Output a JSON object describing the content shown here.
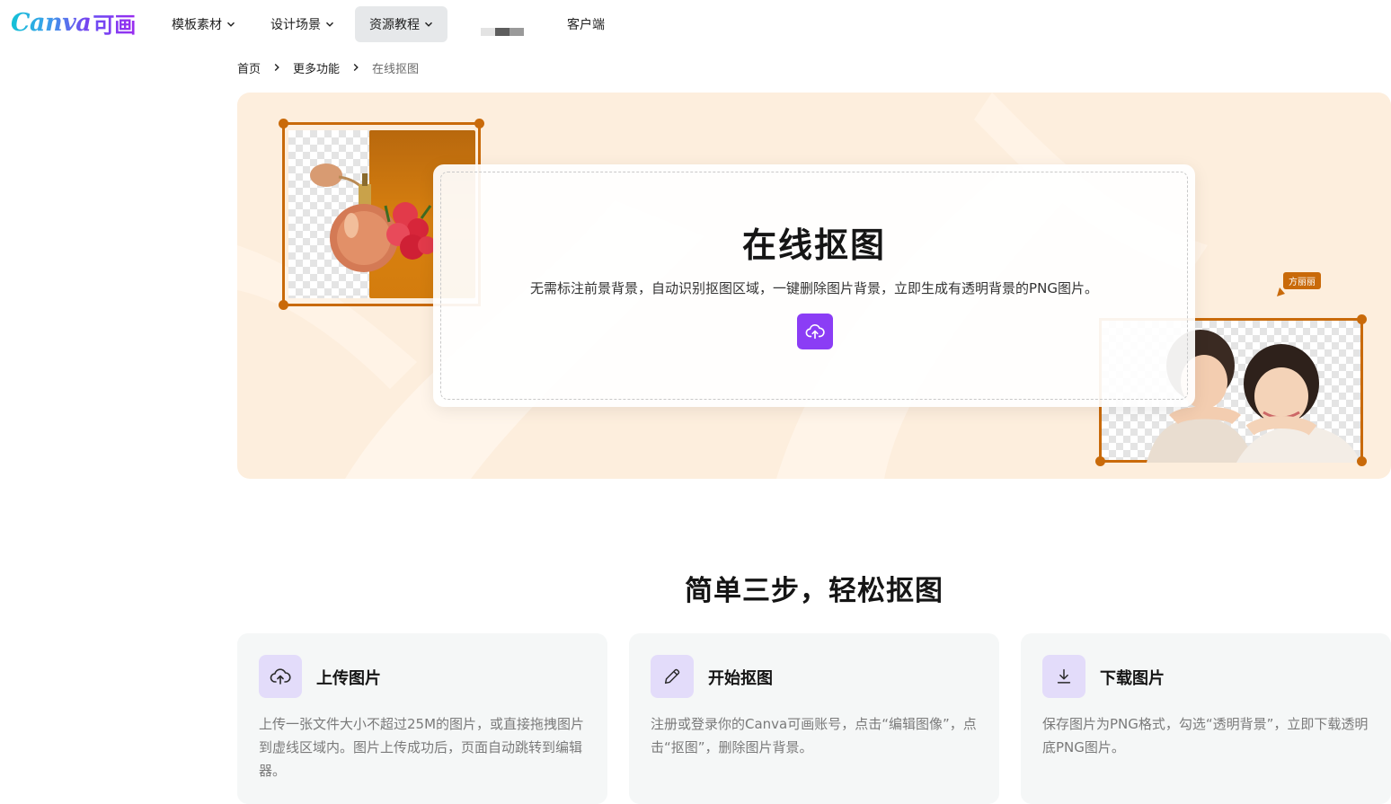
{
  "nav": {
    "logo_text": "Canva",
    "logo_cn": "可画",
    "items": [
      {
        "label": "模板素材"
      },
      {
        "label": "设计场景"
      },
      {
        "label": "资源教程"
      }
    ],
    "client_label": "客户端"
  },
  "breadcrumb": {
    "items": [
      "首页",
      "更多功能"
    ],
    "current": "在线抠图"
  },
  "hero": {
    "title": "在线抠图",
    "description": "无需标注前景背景，自动识别抠图区域，一键删除图片背景，立即生成有透明背景的PNG图片。",
    "upload_icon": "cloud-upload-icon",
    "tag": "方丽丽",
    "accent_color": "#c96a0a",
    "button_color": "#8b3df5"
  },
  "steps": {
    "title": "简单三步，轻松抠图",
    "items": [
      {
        "icon": "cloud-upload-icon",
        "name": "上传图片",
        "desc": "上传一张文件大小不超过25M的图片，或直接拖拽图片到虚线区域内。图片上传成功后，页面自动跳转到编辑器。"
      },
      {
        "icon": "pencil-icon",
        "name": "开始抠图",
        "desc": "注册或登录你的Canva可画账号，点击“编辑图像”，点击“抠图”，删除图片背景。"
      },
      {
        "icon": "download-icon",
        "name": "下载图片",
        "desc": "保存图片为PNG格式，勾选“透明背景”，立即下载透明底PNG图片。"
      }
    ]
  }
}
